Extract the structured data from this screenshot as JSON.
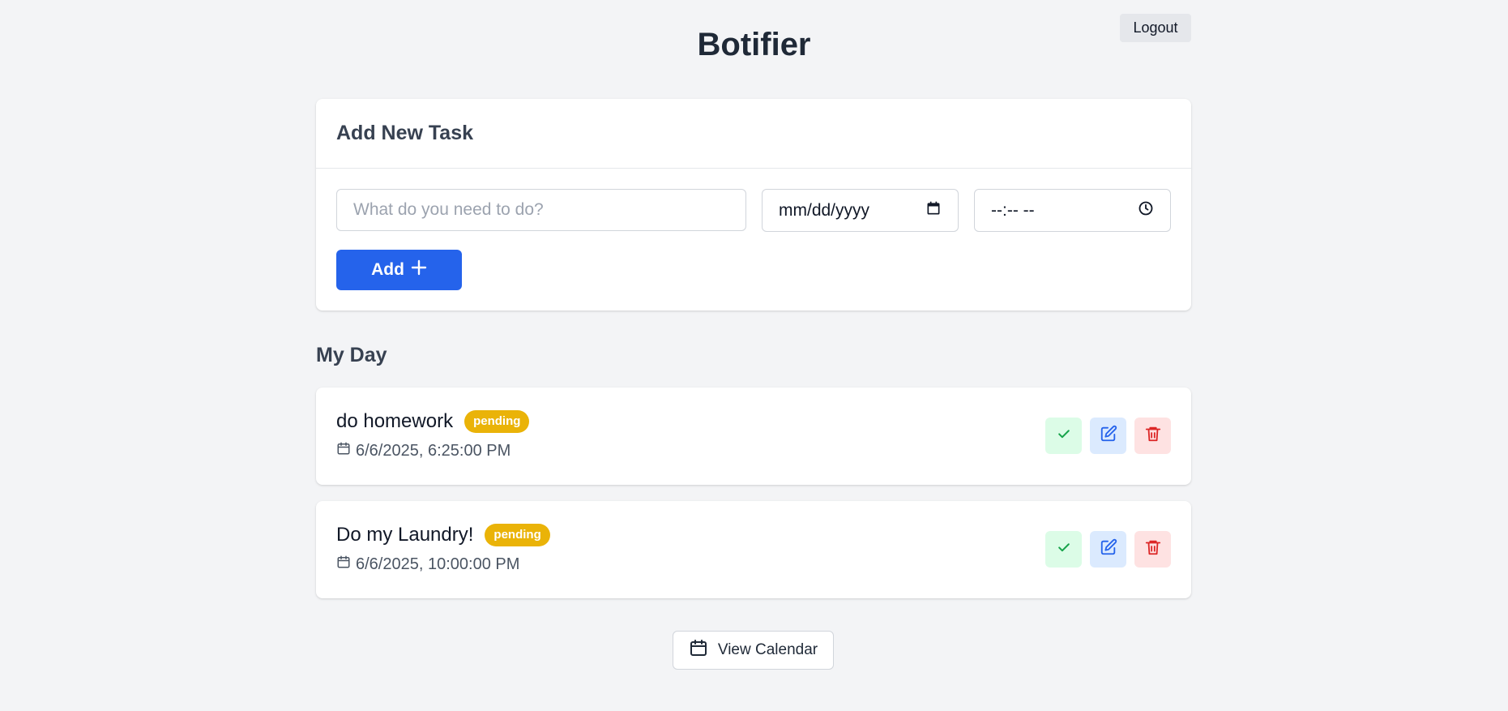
{
  "header": {
    "app_title": "Botifier",
    "logout_label": "Logout"
  },
  "add_task": {
    "heading": "Add New Task",
    "task_placeholder": "What do you need to do?",
    "date_placeholder": "mm/dd/yyyy",
    "time_placeholder": "--:-- --",
    "add_label": "Add"
  },
  "my_day": {
    "heading": "My Day",
    "tasks": [
      {
        "title": "do homework",
        "status": "pending",
        "datetime": "6/6/2025, 6:25:00 PM"
      },
      {
        "title": "Do my Laundry!",
        "status": "pending",
        "datetime": "6/6/2025, 10:00:00 PM"
      }
    ]
  },
  "footer": {
    "calendar_label": "View Calendar"
  },
  "colors": {
    "primary": "#2563eb",
    "pending_badge": "#eab308",
    "complete": "#16a34a",
    "edit": "#2563eb",
    "delete": "#dc2626"
  },
  "icons": {
    "add": "plus-icon",
    "date": "calendar-icon",
    "time": "clock-icon",
    "complete": "check-icon",
    "edit": "edit-icon",
    "delete": "trash-icon"
  }
}
